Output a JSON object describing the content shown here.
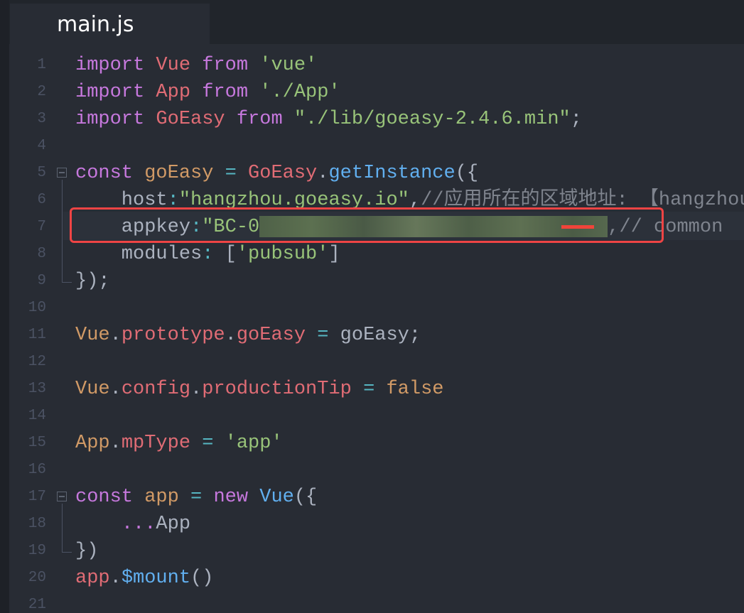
{
  "tab": {
    "title": "main.js"
  },
  "colors": {
    "background": "#282c34",
    "keyword": "#c678dd",
    "class": "#e06c75",
    "string": "#98c379",
    "function": "#61afef",
    "variable": "#d19a66",
    "operator": "#56b6c2",
    "highlight_box": "#ef4444"
  },
  "lines": [
    {
      "n": "1",
      "tokens": [
        [
          "import",
          "kw"
        ],
        [
          " ",
          "pl"
        ],
        [
          "Vue",
          "cls"
        ],
        [
          " ",
          "pl"
        ],
        [
          "from",
          "kw"
        ],
        [
          " ",
          "pl"
        ],
        [
          "'vue'",
          "str"
        ]
      ]
    },
    {
      "n": "2",
      "tokens": [
        [
          "import",
          "kw"
        ],
        [
          " ",
          "pl"
        ],
        [
          "App",
          "cls"
        ],
        [
          " ",
          "pl"
        ],
        [
          "from",
          "kw"
        ],
        [
          " ",
          "pl"
        ],
        [
          "'./App'",
          "str"
        ]
      ]
    },
    {
      "n": "3",
      "tokens": [
        [
          "import",
          "kw"
        ],
        [
          " ",
          "pl"
        ],
        [
          "GoEasy",
          "cls"
        ],
        [
          " ",
          "pl"
        ],
        [
          "from",
          "kw"
        ],
        [
          " ",
          "pl"
        ],
        [
          "\"./lib/goeasy-2.4.6.min\"",
          "str"
        ],
        [
          ";",
          "pl"
        ]
      ]
    },
    {
      "n": "4",
      "tokens": []
    },
    {
      "n": "5",
      "fold": true,
      "tokens": [
        [
          "const",
          "kw"
        ],
        [
          " ",
          "pl"
        ],
        [
          "goEasy",
          "var"
        ],
        [
          " ",
          "pl"
        ],
        [
          "=",
          "op"
        ],
        [
          " ",
          "pl"
        ],
        [
          "GoEasy",
          "cls"
        ],
        [
          ".",
          "pl"
        ],
        [
          "getInstance",
          "fn"
        ],
        [
          "({",
          "pl"
        ]
      ]
    },
    {
      "n": "6",
      "tokens": [
        [
          "    host",
          "pl"
        ],
        [
          ":",
          "op"
        ],
        [
          "\"hangzhou.goeasy.io\"",
          "str"
        ],
        [
          ",",
          "pl"
        ],
        [
          "//应用所在的区域地址: 【hangzhou",
          "cm"
        ]
      ]
    },
    {
      "n": "7",
      "tokens": [
        [
          "    appkey",
          "pl"
        ],
        [
          ":",
          "op"
        ],
        [
          "\"BC-0",
          "str"
        ],
        [
          "",
          "blur"
        ],
        [
          ",// common",
          "cm"
        ]
      ]
    },
    {
      "n": "8",
      "tokens": [
        [
          "    modules",
          "pl"
        ],
        [
          ":",
          "op"
        ],
        [
          " [",
          "pl"
        ],
        [
          "'pubsub'",
          "str"
        ],
        [
          "]",
          "pl"
        ]
      ]
    },
    {
      "n": "9",
      "tokens": [
        [
          "});",
          "pl"
        ]
      ]
    },
    {
      "n": "10",
      "tokens": []
    },
    {
      "n": "11",
      "tokens": [
        [
          "Vue",
          "var"
        ],
        [
          ".",
          "pl"
        ],
        [
          "prototype",
          "cls"
        ],
        [
          ".",
          "pl"
        ],
        [
          "goEasy",
          "cls"
        ],
        [
          " ",
          "pl"
        ],
        [
          "=",
          "op"
        ],
        [
          " goEasy;",
          "pl"
        ]
      ]
    },
    {
      "n": "12",
      "tokens": []
    },
    {
      "n": "13",
      "tokens": [
        [
          "Vue",
          "var"
        ],
        [
          ".",
          "pl"
        ],
        [
          "config",
          "cls"
        ],
        [
          ".",
          "pl"
        ],
        [
          "productionTip",
          "cls"
        ],
        [
          " ",
          "pl"
        ],
        [
          "=",
          "op"
        ],
        [
          " ",
          "pl"
        ],
        [
          "false",
          "var"
        ]
      ]
    },
    {
      "n": "14",
      "tokens": []
    },
    {
      "n": "15",
      "tokens": [
        [
          "App",
          "var"
        ],
        [
          ".",
          "pl"
        ],
        [
          "mpType",
          "cls"
        ],
        [
          " ",
          "pl"
        ],
        [
          "=",
          "op"
        ],
        [
          " ",
          "pl"
        ],
        [
          "'app'",
          "str"
        ]
      ]
    },
    {
      "n": "16",
      "tokens": []
    },
    {
      "n": "17",
      "fold": true,
      "tokens": [
        [
          "const",
          "kw"
        ],
        [
          " ",
          "pl"
        ],
        [
          "app",
          "var"
        ],
        [
          " ",
          "pl"
        ],
        [
          "=",
          "op"
        ],
        [
          " ",
          "pl"
        ],
        [
          "new",
          "kw"
        ],
        [
          " ",
          "pl"
        ],
        [
          "Vue",
          "fn"
        ],
        [
          "({",
          "pl"
        ]
      ]
    },
    {
      "n": "18",
      "tokens": [
        [
          "    ",
          "pl"
        ],
        [
          "...",
          "kw"
        ],
        [
          "App",
          "pl"
        ]
      ]
    },
    {
      "n": "19",
      "tokens": [
        [
          "})",
          "pl"
        ]
      ]
    },
    {
      "n": "20",
      "tokens": [
        [
          "app",
          "cls"
        ],
        [
          ".",
          "pl"
        ],
        [
          "$mount",
          "fn"
        ],
        [
          "()",
          "pl"
        ]
      ]
    },
    {
      "n": "21",
      "tokens": []
    }
  ]
}
